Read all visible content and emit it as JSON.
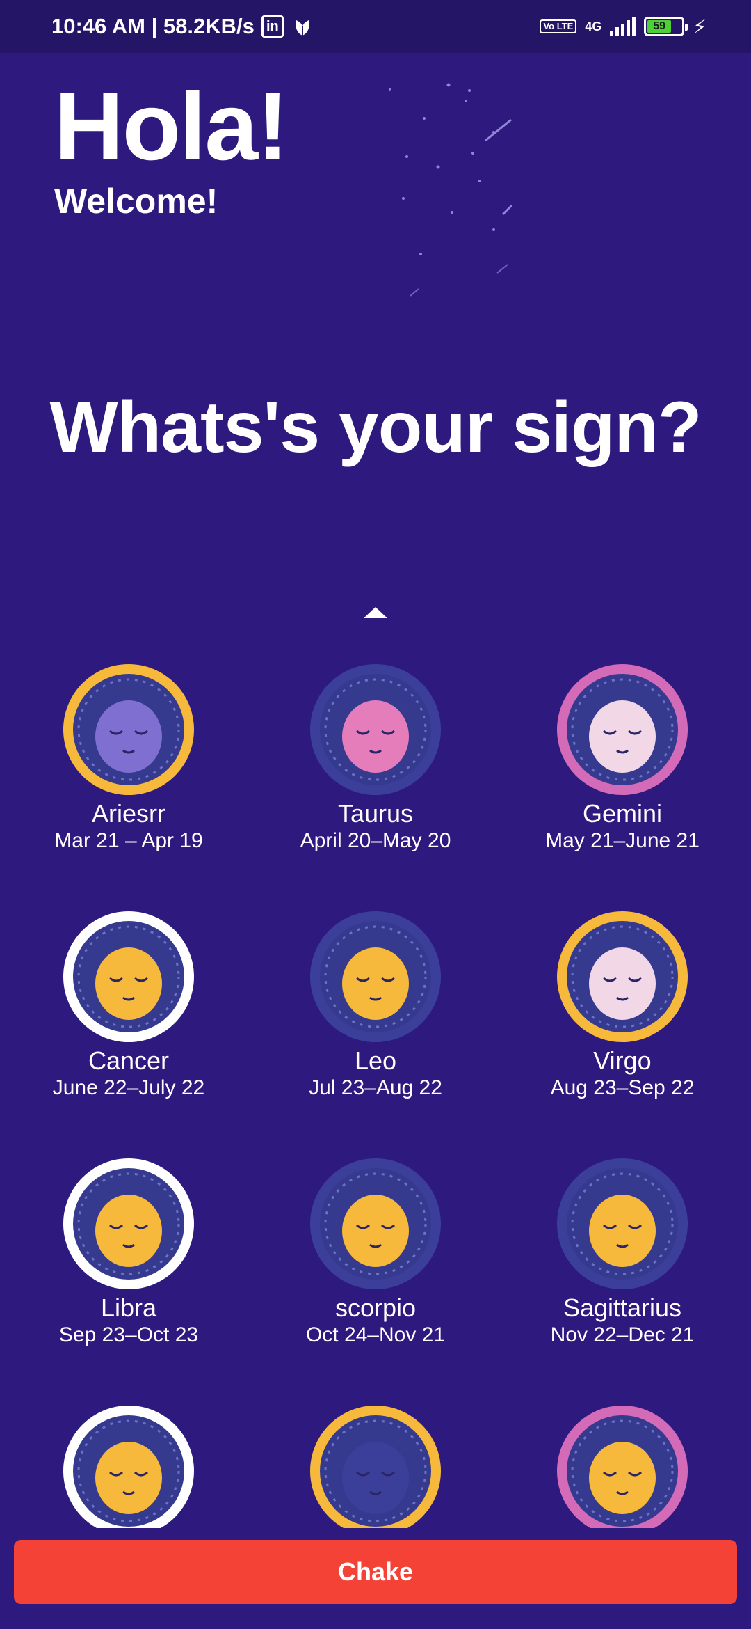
{
  "status_bar": {
    "time_speed": "10:46 AM | 58.2KB/s",
    "linkedin_icon": "linkedin-icon",
    "volte": "Vo LTE",
    "network": "4G",
    "battery": "59",
    "colors": {
      "battery_fill": "#4cd137"
    }
  },
  "header": {
    "title": "Hola!",
    "subtitle": "Welcome!"
  },
  "question": "Whats's your sign?",
  "signs": [
    {
      "name": "Ariesrr",
      "dates": "Mar 21 – Apr 19",
      "icon": "aries-icon",
      "ring": "#f6b93b",
      "face": "#7f6fd1"
    },
    {
      "name": "Taurus",
      "dates": "April 20–May 20",
      "icon": "taurus-icon",
      "ring": "#3b3f9a",
      "face": "#e57dbb"
    },
    {
      "name": "Gemini",
      "dates": "May 21–June 21",
      "icon": "gemini-icon",
      "ring": "#d36bb8",
      "face": "#f2d8e6"
    },
    {
      "name": "Cancer",
      "dates": "June 22–July 22",
      "icon": "cancer-icon",
      "ring": "#ffffff",
      "face": "#f6b93b"
    },
    {
      "name": "Leo",
      "dates": "Jul 23–Aug 22",
      "icon": "leo-icon",
      "ring": "#3b3f9a",
      "face": "#f6b93b"
    },
    {
      "name": "Virgo",
      "dates": "Aug 23–Sep 22",
      "icon": "virgo-icon",
      "ring": "#f6b93b",
      "face": "#f2d8e6"
    },
    {
      "name": "Libra",
      "dates": "Sep 23–Oct 23",
      "icon": "libra-icon",
      "ring": "#ffffff",
      "face": "#f6b93b"
    },
    {
      "name": "scorpio",
      "dates": "Oct 24–Nov 21",
      "icon": "scorpio-icon",
      "ring": "#3b3f9a",
      "face": "#f6b93b"
    },
    {
      "name": "Sagittarius",
      "dates": "Nov 22–Dec 21",
      "icon": "sagittarius-icon",
      "ring": "#3b3f9a",
      "face": "#f6b93b"
    },
    {
      "name": "",
      "dates": "",
      "icon": "capricorn-icon",
      "ring": "#ffffff",
      "face": "#f6b93b"
    },
    {
      "name": "",
      "dates": "",
      "icon": "aquarius-icon",
      "ring": "#f6b93b",
      "face": "#3b3f9a"
    },
    {
      "name": "",
      "dates": "",
      "icon": "pisces-icon",
      "ring": "#d36bb8",
      "face": "#f6b93b"
    }
  ],
  "action_button": {
    "label": "Chake",
    "color": "#f44336"
  }
}
